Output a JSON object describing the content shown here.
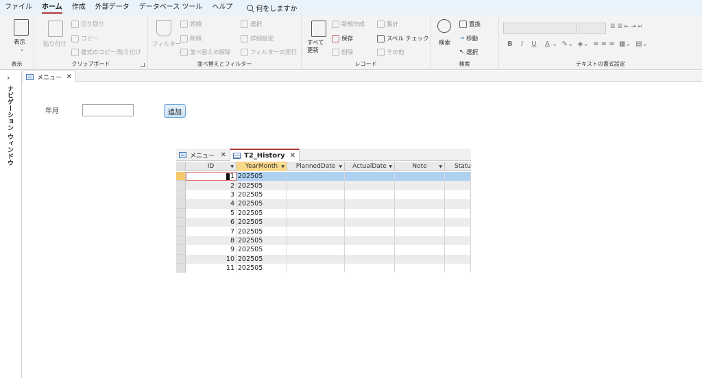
{
  "menu": {
    "items": [
      "ファイル",
      "ホーム",
      "作成",
      "外部データ",
      "データベース ツール",
      "ヘルプ"
    ],
    "active_index": 1,
    "search_text": "何をしますか"
  },
  "ribbon": {
    "groups": {
      "view": {
        "label": "表示",
        "button": "表示"
      },
      "clipboard": {
        "label": "クリップボード",
        "paste": "貼り付け",
        "cut": "切り取り",
        "copy": "コピー",
        "format_painter": "書式のコピー/貼り付け"
      },
      "sort_filter": {
        "label": "並べ替えとフィルター",
        "filter": "フィルター",
        "ascending": "昇順",
        "descending": "降順",
        "remove_sort": "並べ替えの解除",
        "selection": "選択",
        "advanced": "詳細設定",
        "toggle_filter": "フィルターの実行"
      },
      "records": {
        "label": "レコード",
        "refresh": "すべて更新",
        "new": "新規作成",
        "save": "保存",
        "delete": "削除",
        "totals": "集計",
        "spelling": "スペル チェック",
        "more": "その他"
      },
      "find": {
        "label": "検索",
        "find": "検索",
        "replace": "置換",
        "goto": "移動",
        "select": "選択"
      },
      "text_format": {
        "label": "テキストの書式設定"
      }
    }
  },
  "nav_pane": {
    "label": "ナビゲーション ウィンドウ"
  },
  "doc_tab": {
    "label": "メニュー"
  },
  "form": {
    "month_label": "年月",
    "month_value": "",
    "add_button": "追加"
  },
  "datasheet": {
    "tabs": [
      "メニュー",
      "T2_History"
    ],
    "active_tab": 1,
    "columns": [
      "ID",
      "YearMonth",
      "PlannedDate",
      "ActualDate",
      "Note",
      "Statu"
    ],
    "rows": [
      {
        "id": "1",
        "yearmonth": "202505"
      },
      {
        "id": "2",
        "yearmonth": "202505"
      },
      {
        "id": "3",
        "yearmonth": "202505"
      },
      {
        "id": "4",
        "yearmonth": "202505"
      },
      {
        "id": "5",
        "yearmonth": "202505"
      },
      {
        "id": "6",
        "yearmonth": "202505"
      },
      {
        "id": "7",
        "yearmonth": "202505"
      },
      {
        "id": "8",
        "yearmonth": "202505"
      },
      {
        "id": "9",
        "yearmonth": "202505"
      },
      {
        "id": "10",
        "yearmonth": "202505"
      },
      {
        "id": "11",
        "yearmonth": "202505"
      }
    ],
    "current_row": 0
  }
}
